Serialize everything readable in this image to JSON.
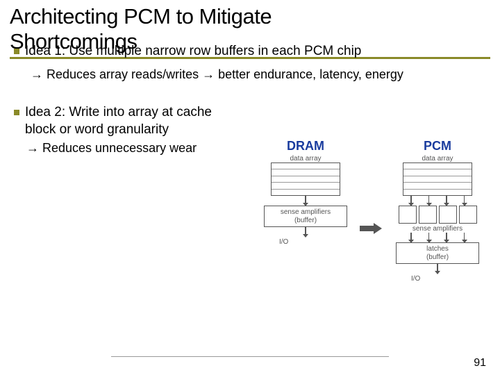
{
  "title_line1": "Architecting PCM to Mitigate",
  "title_line2": "Shortcomings",
  "idea1": "Idea 1: Use multiple narrow row buffers in each PCM chip",
  "idea1_sub": "→ Reduces array reads/writes → better endurance, latency, energy",
  "idea2": "Idea 2: Write into array at cache block or word granularity",
  "idea2_sub": "→ Reduces unnecessary wear",
  "diagram": {
    "left_header": "DRAM",
    "right_header": "PCM",
    "data_array": "data array",
    "sense_amp": "sense amplifiers",
    "buffer": "(buffer)",
    "latches": "latches",
    "io": "I/O"
  },
  "page_number": "91"
}
